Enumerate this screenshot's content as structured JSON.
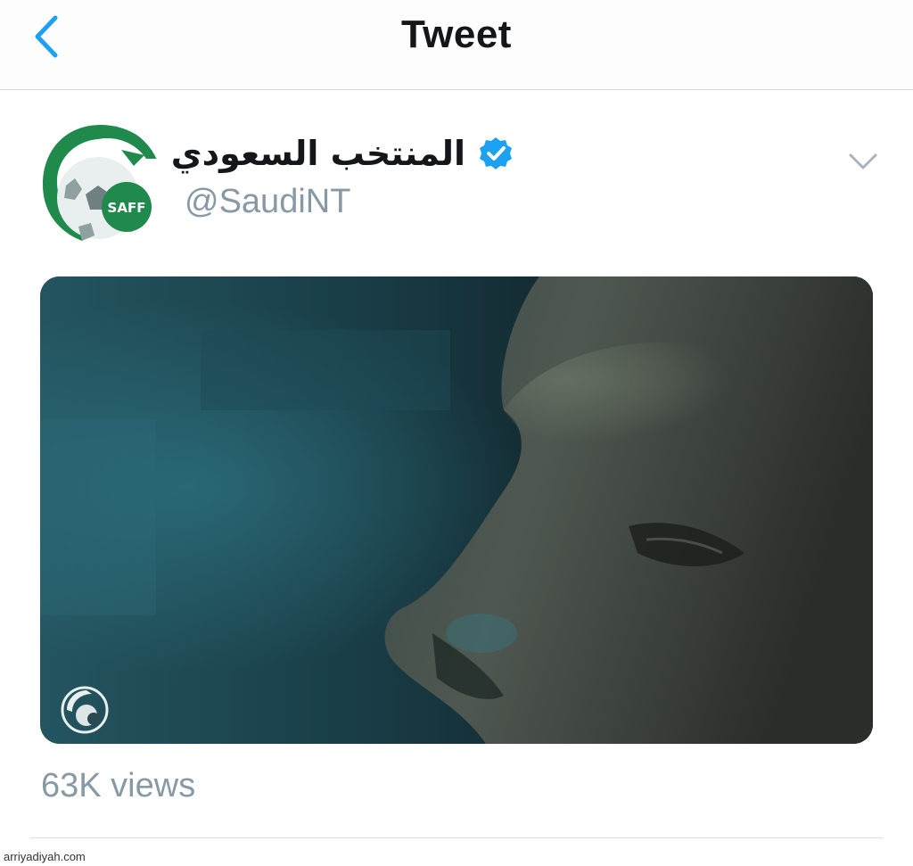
{
  "header": {
    "title": "Tweet",
    "back_icon": "chevron-left-icon"
  },
  "tweet": {
    "author": {
      "name": "المنتخب السعودي",
      "handle": "@SaudiNT",
      "verified": true,
      "avatar_text": "SAFF"
    },
    "media": {
      "type": "video"
    },
    "views_label": "63K views"
  },
  "watermark": "arriyadiyah.com",
  "colors": {
    "accent": "#1da1f2",
    "title": "#14171a",
    "muted": "#8899a6",
    "saff_green": "#1f8a4c"
  }
}
